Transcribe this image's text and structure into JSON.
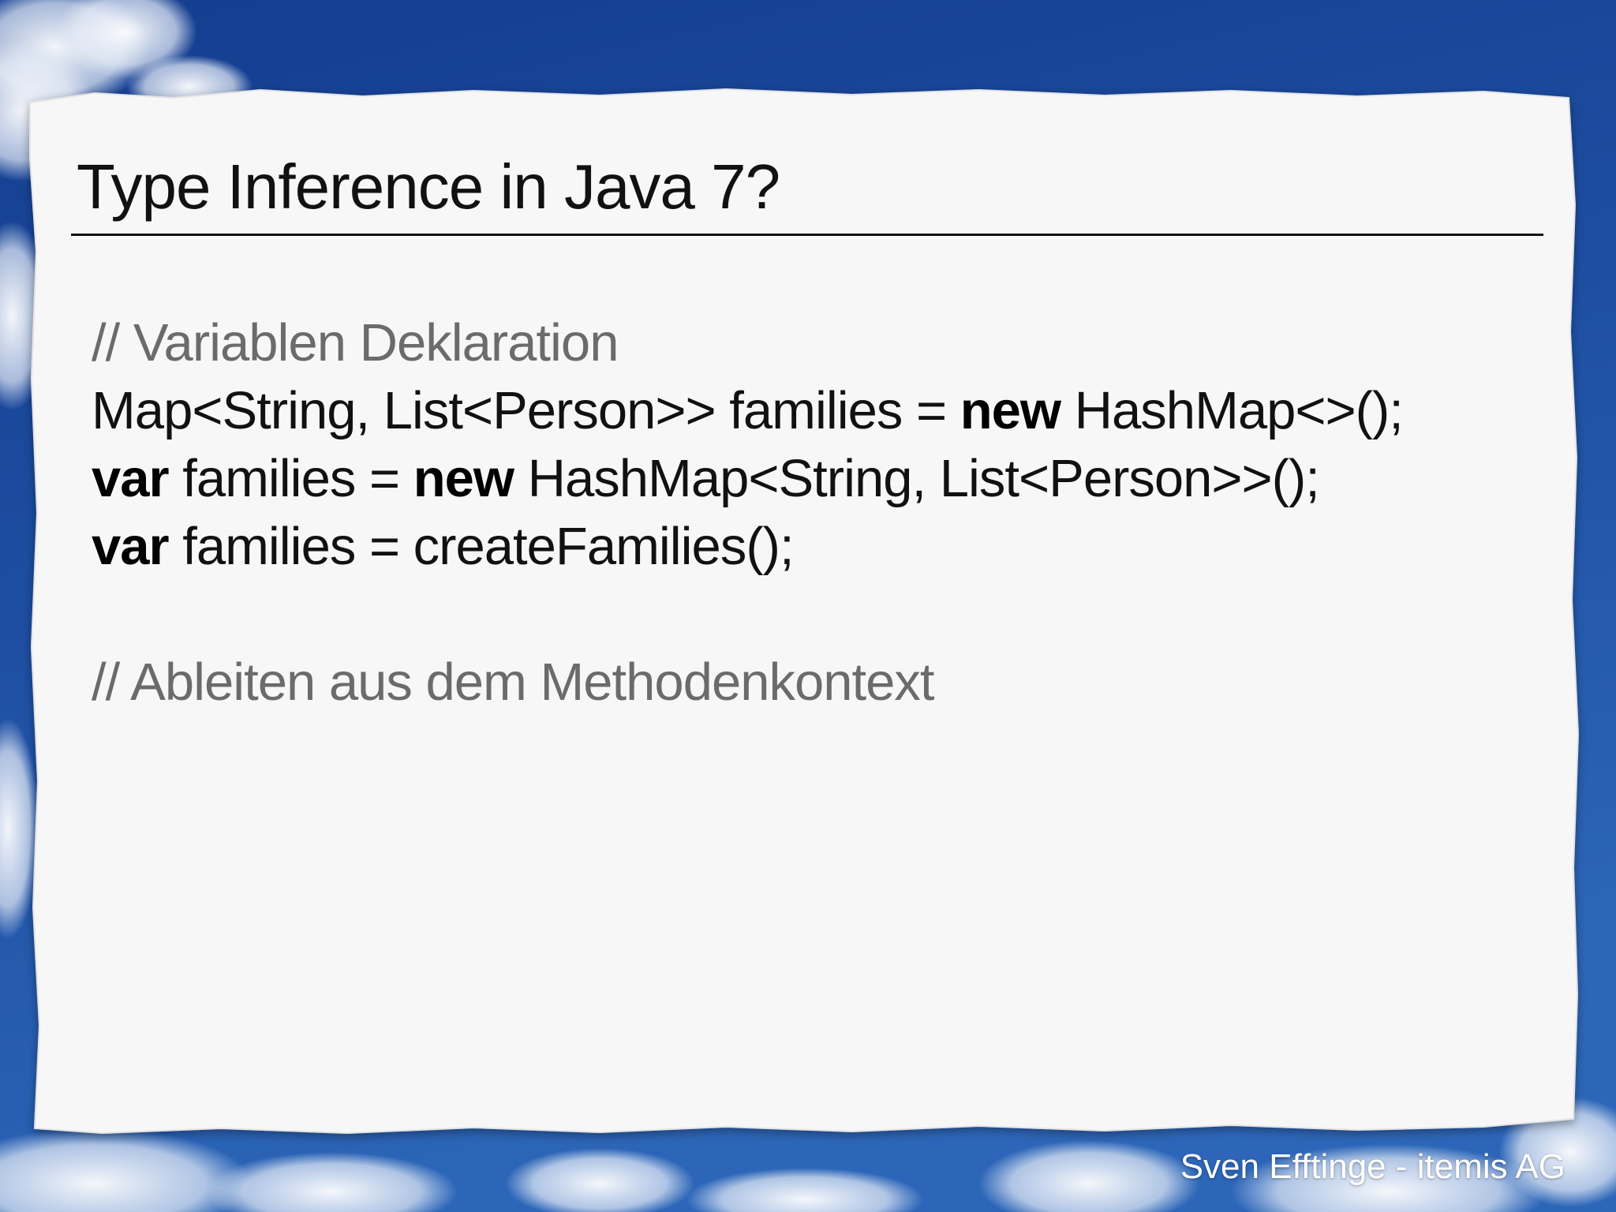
{
  "slide": {
    "title": "Type Inference in Java 7?",
    "lines": [
      {
        "segments": [
          {
            "text": "// Variablen Deklaration",
            "kind": "comment"
          }
        ]
      },
      {
        "segments": [
          {
            "text": "Map<String, List<Person>> families = ",
            "kind": "code"
          },
          {
            "text": "new",
            "kind": "keyword"
          },
          {
            "text": " HashMap<>();",
            "kind": "code"
          }
        ]
      },
      {
        "segments": [
          {
            "text": "var",
            "kind": "keyword"
          },
          {
            "text": " families = ",
            "kind": "code"
          },
          {
            "text": "new",
            "kind": "keyword"
          },
          {
            "text": " HashMap<String, List<Person>>();",
            "kind": "code"
          }
        ]
      },
      {
        "segments": [
          {
            "text": "var",
            "kind": "keyword"
          },
          {
            "text": " families = createFamilies();",
            "kind": "code"
          }
        ]
      },
      {
        "segments": []
      },
      {
        "segments": [
          {
            "text": "// Ableiten aus dem Methodenkontext",
            "kind": "comment"
          }
        ]
      }
    ],
    "footer": "Sven Efftinge - itemis AG"
  },
  "colors": {
    "sky_top": "#143d8f",
    "sky_bottom": "#2a64b5",
    "paper": "#f7f7f7",
    "text": "#111111",
    "comment": "#6b6b6b",
    "footer": "#ffffff"
  }
}
